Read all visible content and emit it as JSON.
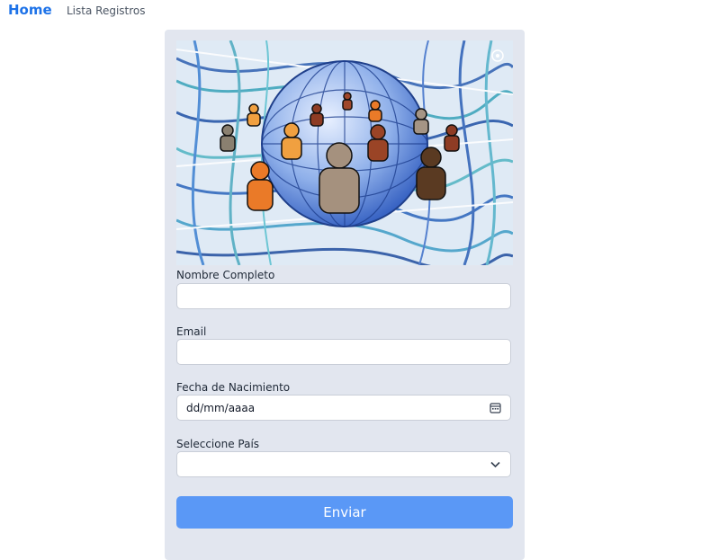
{
  "nav": {
    "home": "Home",
    "registros": "Lista Registros"
  },
  "form": {
    "nombre_label": "Nombre Completo",
    "nombre_value": "",
    "email_label": "Email",
    "email_value": "",
    "fecha_label": "Fecha de Nacimiento",
    "fecha_placeholder": "dd/mm/aaaa",
    "pais_label": "Seleccione País",
    "pais_value": "",
    "submit_label": "Enviar"
  },
  "icons": {
    "calendar": "calendar-icon",
    "dropdown": "chevron-down-icon",
    "image_corner": "image-settings-icon"
  },
  "colors": {
    "nav_home": "#1d72e8",
    "card_bg": "#e2e6ef",
    "submit_bg": "#5a98f6",
    "globe": "#5b7fd6"
  }
}
